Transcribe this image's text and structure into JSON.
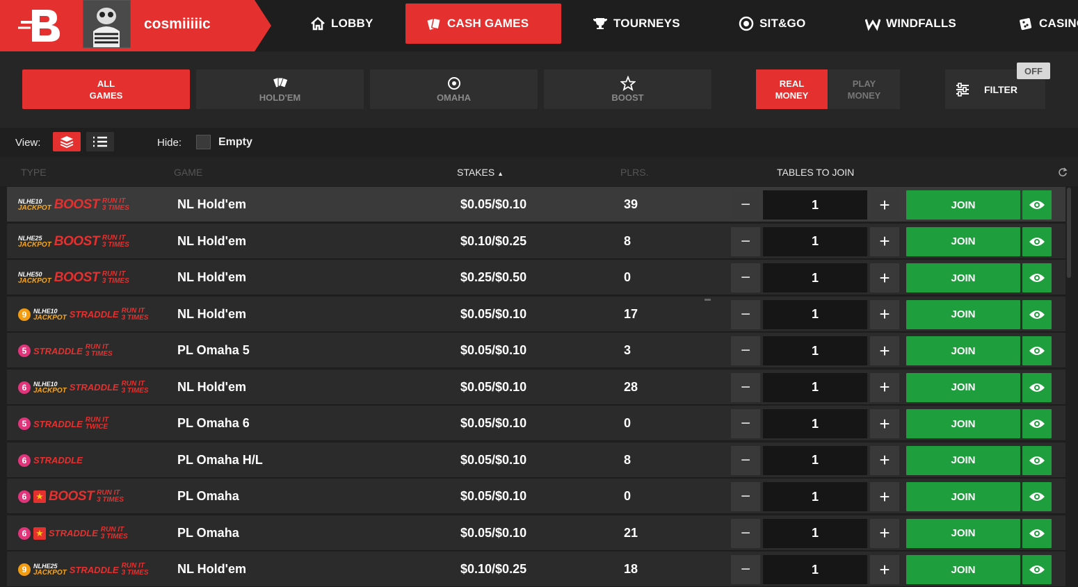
{
  "user": {
    "name": "cosmiiiiic"
  },
  "nav": {
    "items": [
      {
        "label": "LOBBY",
        "icon": "home-icon"
      },
      {
        "label": "CASH GAMES",
        "icon": "cards-icon",
        "active": true
      },
      {
        "label": "TOURNEYS",
        "icon": "trophy-icon"
      },
      {
        "label": "SIT&GO",
        "icon": "chip-icon"
      },
      {
        "label": "WINDFALLS",
        "icon": "windfall-icon"
      },
      {
        "label": "CASINO",
        "icon": "dice-icon"
      }
    ]
  },
  "categories": [
    {
      "label": "ALL\nGAMES",
      "active": true
    },
    {
      "label": "HOLD'EM",
      "icon": "cards-fan-icon"
    },
    {
      "label": "OMAHA",
      "icon": "omaha-icon"
    },
    {
      "label": "BOOST",
      "icon": "star-icon"
    }
  ],
  "money": {
    "real": "REAL\nMONEY",
    "play": "PLAY\nMONEY"
  },
  "filter": {
    "label": "FILTER",
    "badge": "OFF"
  },
  "view": {
    "label": "View:",
    "hide_label": "Hide:",
    "empty_label": "Empty"
  },
  "columns": {
    "type": "TYPE",
    "game": "GAME",
    "stakes": "STAKES",
    "plrs": "PLRS.",
    "tables": "TABLES TO JOIN"
  },
  "colors": {
    "accent": "#e4312f",
    "join": "#1f9e3e",
    "jackpot": "#f5a623",
    "orange_badge": "#f39c12",
    "pink_badge": "#e0357a"
  },
  "join_label": "JOIN",
  "rows": [
    {
      "num": "",
      "num_color": "",
      "jackpot": "NLHE10",
      "tag": "BOOST",
      "run": "RUN IT\n3 TIMES",
      "star": false,
      "game": "NL Hold'em",
      "stakes": "$0.05/$0.10",
      "plrs": "39",
      "qty": "1"
    },
    {
      "num": "",
      "num_color": "",
      "jackpot": "NLHE25",
      "tag": "BOOST",
      "run": "RUN IT\n3 TIMES",
      "star": false,
      "game": "NL Hold'em",
      "stakes": "$0.10/$0.25",
      "plrs": "8",
      "qty": "1"
    },
    {
      "num": "",
      "num_color": "",
      "jackpot": "NLHE50",
      "tag": "BOOST",
      "run": "RUN IT\n3 TIMES",
      "star": false,
      "game": "NL Hold'em",
      "stakes": "$0.25/$0.50",
      "plrs": "0",
      "qty": "1"
    },
    {
      "num": "9",
      "num_color": "#f39c12",
      "jackpot": "NLHE10",
      "tag": "STRADDLE",
      "run": "RUN IT\n3 TIMES",
      "star": false,
      "game": "NL Hold'em",
      "stakes": "$0.05/$0.10",
      "plrs": "17",
      "qty": "1"
    },
    {
      "num": "5",
      "num_color": "#e0357a",
      "jackpot": "",
      "tag": "STRADDLE",
      "run": "RUN IT\n3 TIMES",
      "star": false,
      "game": "PL Omaha 5",
      "stakes": "$0.05/$0.10",
      "plrs": "3",
      "qty": "1"
    },
    {
      "num": "6",
      "num_color": "#e0357a",
      "jackpot": "NLHE10",
      "tag": "STRADDLE",
      "run": "RUN IT\n3 TIMES",
      "star": false,
      "game": "NL Hold'em",
      "stakes": "$0.05/$0.10",
      "plrs": "28",
      "qty": "1"
    },
    {
      "num": "5",
      "num_color": "#e0357a",
      "jackpot": "",
      "tag": "STRADDLE",
      "run": "RUN IT\nTWICE",
      "star": false,
      "game": "PL Omaha 6",
      "stakes": "$0.05/$0.10",
      "plrs": "0",
      "qty": "1"
    },
    {
      "num": "6",
      "num_color": "#e0357a",
      "jackpot": "",
      "tag": "STRADDLE",
      "run": "",
      "star": false,
      "game": "PL Omaha H/L",
      "stakes": "$0.05/$0.10",
      "plrs": "8",
      "qty": "1"
    },
    {
      "num": "6",
      "num_color": "#e0357a",
      "jackpot": "",
      "tag": "BOOST",
      "run": "RUN IT\n3 TIMES",
      "star": true,
      "game": "PL Omaha",
      "stakes": "$0.05/$0.10",
      "plrs": "0",
      "qty": "1"
    },
    {
      "num": "6",
      "num_color": "#e0357a",
      "jackpot": "",
      "tag": "STRADDLE",
      "run": "RUN IT\n3 TIMES",
      "star": true,
      "game": "PL Omaha",
      "stakes": "$0.05/$0.10",
      "plrs": "21",
      "qty": "1"
    },
    {
      "num": "9",
      "num_color": "#f39c12",
      "jackpot": "NLHE25",
      "tag": "STRADDLE",
      "run": "RUN IT\n3 TIMES",
      "star": false,
      "game": "NL Hold'em",
      "stakes": "$0.10/$0.25",
      "plrs": "18",
      "qty": "1"
    }
  ]
}
